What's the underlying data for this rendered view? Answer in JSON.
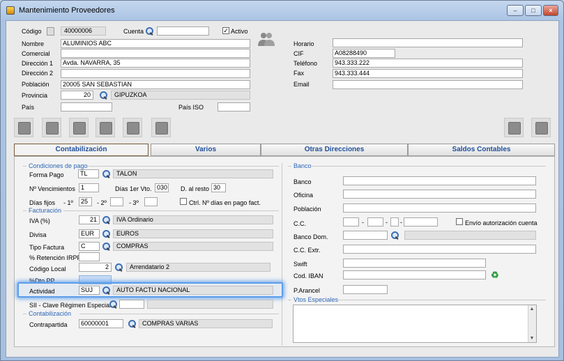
{
  "window": {
    "title": "Mantenimiento Proveedores",
    "min_label": "–",
    "max_label": "□",
    "close_label": "×"
  },
  "top": {
    "codigo_label": "Código",
    "codigo_value": "40000006",
    "cuenta_label": "Cuenta",
    "cuenta_value": "",
    "activo_label": "Activo",
    "activo_checked": true,
    "check_mark": "✓",
    "nombre_label": "Nombre",
    "nombre_value": "ALUMINIOS ABC",
    "comercial_label": "Comercial",
    "comercial_value": "",
    "direccion1_label": "Dirección 1",
    "direccion1_value": "Avda. NAVARRA, 35",
    "direccion2_label": "Dirección 2",
    "direccion2_value": "",
    "poblacion_label": "Población",
    "poblacion_value": "20005 SAN SEBASTIAN",
    "provincia_label": "Provincia",
    "provincia_code": "20",
    "provincia_name": "GIPUZKOA",
    "pais_label": "País",
    "pais_value": "",
    "paisiso_label": "País ISO",
    "paisiso_value": "",
    "horario_label": "Horario",
    "horario_value": "",
    "cif_label": "CIF",
    "cif_value": "A08288490",
    "telefono_label": "Teléfono",
    "telefono_value": "943.333.222",
    "fax_label": "Fax",
    "fax_value": "943.333.444",
    "email_label": "Email",
    "email_value": ""
  },
  "tabs": [
    {
      "label": "Contabilización",
      "active": true
    },
    {
      "label": "Varios",
      "active": false
    },
    {
      "label": "Otras Direcciones",
      "active": false
    },
    {
      "label": "Saldos Contables",
      "active": false
    }
  ],
  "condiciones": {
    "section": "Condiciones de pago",
    "forma_pago_label": "Forma Pago",
    "forma_pago_code": "TL",
    "forma_pago_name": "TALON",
    "vencimientos_label": "Nº Vencimientos",
    "vencimientos_value": "1",
    "dias1er_label": "Días 1er Vto.",
    "dias1er_value": "030",
    "alresto_label": "D. al resto",
    "alresto_value": "30",
    "diasfijos_label": "Días fijos",
    "d1_label": "- 1º",
    "d1_value": "25",
    "d2_label": "- 2º",
    "d2_value": "",
    "d3_label": "- 3º",
    "d3_value": "",
    "ctrl_label": "Ctrl. Nº días en pago fact."
  },
  "facturacion": {
    "section": "Facturación",
    "iva_label": "IVA (%)",
    "iva_code": "21",
    "iva_name": "IVA Ordinario",
    "divisa_label": "Divisa",
    "divisa_code": "EUR",
    "divisa_name": "EUROS",
    "tipo_label": "Tipo Factura",
    "tipo_code": "C",
    "tipo_name": "COMPRAS",
    "irpf_label": "% Retención IRPF",
    "irpf_value": "",
    "codlocal_label": "Código Local",
    "codlocal_value": "2",
    "codlocal_name": "Arrendatario 2",
    "dto_label": "%Dto PP",
    "dto_value": "",
    "actividad_label": "Actividad",
    "actividad_code": "SUJ",
    "actividad_name": "AUTO FACTU NACIONAL",
    "sii_label": "SII - Clave Régimen Especial",
    "sii_value": "",
    "sii_name": ""
  },
  "contabilizacion": {
    "section": "Contabilización",
    "contrapartida_label": "Contrapartida",
    "contrapartida_code": "60000001",
    "contrapartida_name": "COMPRAS VARIAS"
  },
  "banco": {
    "section": "Banco",
    "banco_label": "Banco",
    "banco_value": "",
    "oficina_label": "Oficina",
    "oficina_value": "",
    "poblacion_label": "Población",
    "poblacion_value": "",
    "cc_label": "C.C.",
    "cc_sep": "-",
    "envio_label": "Envío autorización cuenta",
    "bancodom_label": "Banco Dom.",
    "bancodom_value": "",
    "ccextr_label": "C.C. Extr.",
    "ccextr_value": "",
    "swift_label": "Swift",
    "swift_value": "",
    "iban_label": "Cod. IBAN",
    "iban_value": "",
    "parancel_label": "P.Arancel",
    "parancel_value": ""
  },
  "vtos": {
    "section": "Vtos Especiales",
    "scroll_up": "▲",
    "scroll_down": "▼"
  },
  "icons": {
    "recycle_glyph": "♻"
  }
}
